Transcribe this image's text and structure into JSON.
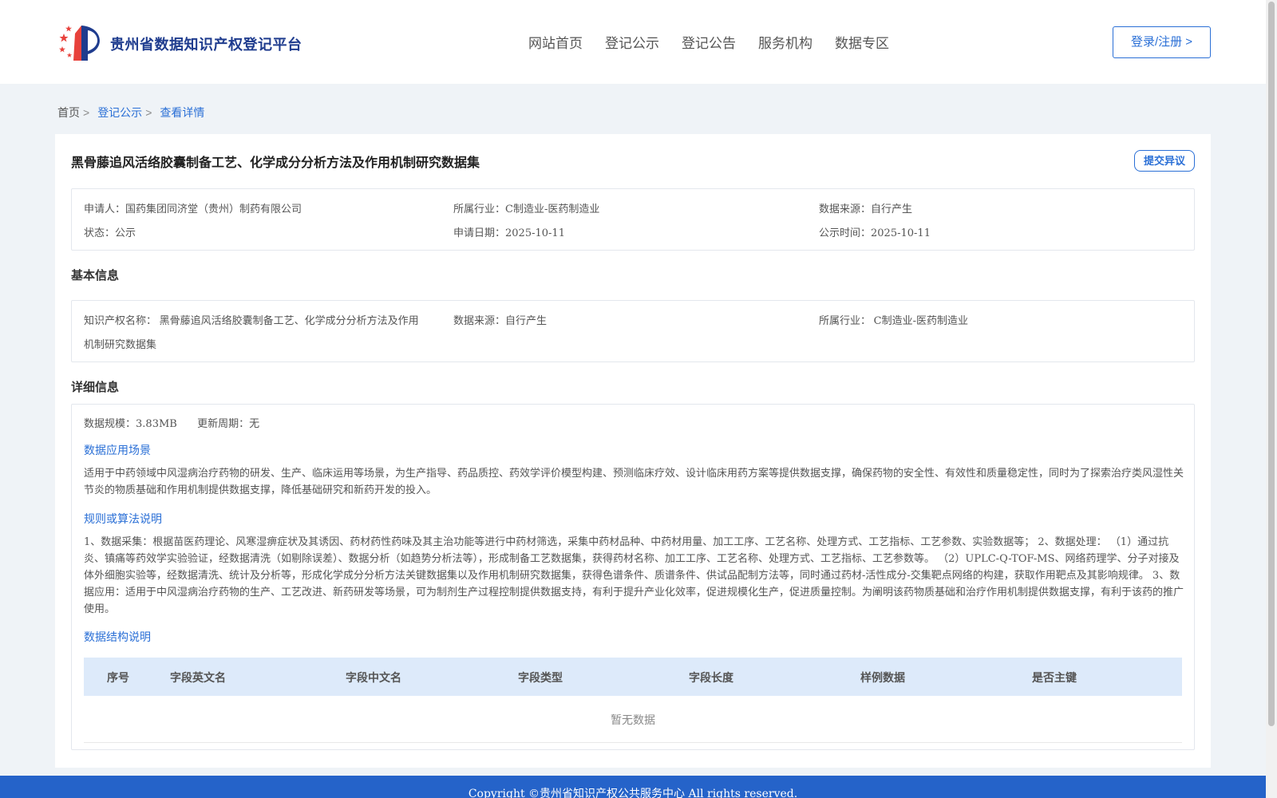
{
  "header": {
    "site_title": "贵州省数据知识产权登记平台",
    "nav": [
      "网站首页",
      "登记公示",
      "登记公告",
      "服务机构",
      "数据专区"
    ],
    "login_label": "登录/注册 >"
  },
  "breadcrumb": {
    "home": "首页",
    "sep": ">",
    "publicity": "登记公示",
    "current": "查看详情"
  },
  "detail": {
    "title": "黑骨藤追风活络胶囊制备工艺、化学成分分析方法及作用机制研究数据集",
    "objection_label": "提交异议",
    "summary": {
      "applicant_label": "申请人：",
      "applicant": "国药集团同济堂（贵州）制药有限公司",
      "industry_label": "所属行业：",
      "industry": "C制造业-医药制造业",
      "source_label": "数据来源：",
      "source": "自行产生",
      "status_label": "状态：",
      "status": "公示",
      "apply_date_label": "申请日期：",
      "apply_date": "2025-10-11",
      "publicity_time_label": "公示时间：",
      "publicity_time": "2025-10-11"
    },
    "basic": {
      "section_title": "基本信息",
      "ip_name_label": "知识产权名称：",
      "ip_name_line1": "黑骨藤追风活络胶囊制备工艺、化学成分分析方法及作用",
      "ip_name_line2": "机制研究数据集",
      "source_label": "数据来源：",
      "source": "自行产生",
      "industry_label": "所属行业：",
      "industry": "C制造业-医药制造业"
    },
    "info": {
      "section_title": "详细信息",
      "scale_label": "数据规模：",
      "scale": "3.83MB",
      "cycle_label": "更新周期：",
      "cycle": "无",
      "scenario_title": "数据应用场景",
      "scenario_text": "适用于中药领域中风湿病治疗药物的研发、生产、临床运用等场景，为生产指导、药品质控、药效学评价模型构建、预测临床疗效、设计临床用药方案等提供数据支撑，确保药物的安全性、有效性和质量稳定性，同时为了探索治疗类风湿性关节炎的物质基础和作用机制提供数据支撑，降低基础研究和新药开发的投入。",
      "rules_title": "规则或算法说明",
      "rules_text": "1、数据采集：根据苗医药理论、风寒湿痹症状及其诱因、药材药性药味及其主治功能等进行中药材筛选，采集中药材品种、中药材用量、加工工序、工艺名称、处理方式、工艺指标、工艺参数、实验数据等； 2、数据处理： （1）通过抗炎、镇痛等药效学实验验证，经数据清洗（如剔除误差）、数据分析（如趋势分析法等），形成制备工艺数据集，获得药材名称、加工工序、工艺名称、处理方式、工艺指标、工艺参数等。 （2）UPLC-Q-TOF-MS、网络药理学、分子对接及体外细胞实验等，经数据清洗、统计及分析等，形成化学成分分析方法关键数据集以及作用机制研究数据集，获得色谱条件、质谱条件、供试品配制方法等，同时通过药材-活性成分-交集靶点网络的构建，获取作用靶点及其影响规律。 3、数据应用：适用于中风湿病治疗药物的生产、工艺改进、新药研发等场景，可为制剂生产过程控制提供数据支持，有利于提升产业化效率，促进规模化生产，促进质量控制。为阐明该药物质基础和治疗作用机制提供数据支撑，有利于该药的推广使用。",
      "structure_title": "数据结构说明",
      "columns": [
        "序号",
        "字段英文名",
        "字段中文名",
        "字段类型",
        "字段长度",
        "样例数据",
        "是否主键"
      ],
      "empty_text": "暂无数据"
    }
  },
  "footer": {
    "text": "Copyright ©贵州省知识产权公共服务中心 All rights reserved."
  },
  "colors": {
    "accent": "#2a6fd6",
    "footer_bg": "#2563c9",
    "table_head_bg": "#ddeafa",
    "page_bg": "#eff3f7"
  }
}
